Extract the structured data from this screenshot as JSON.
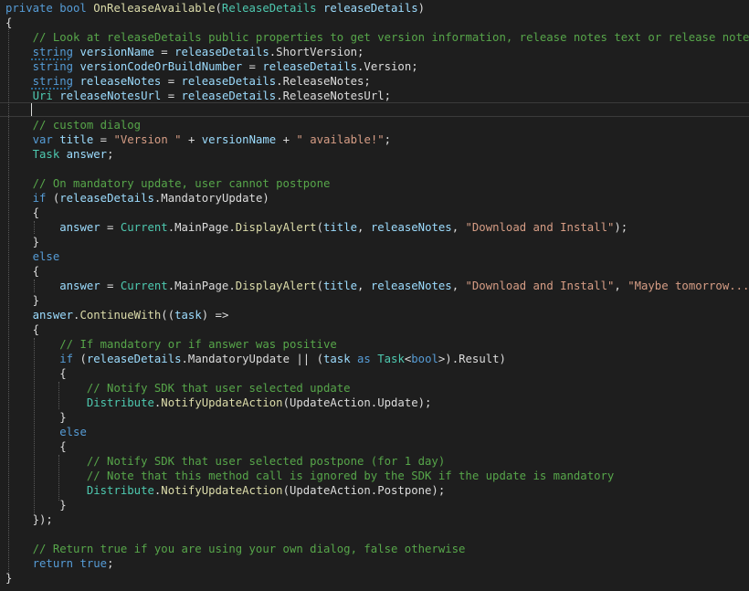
{
  "colors": {
    "background": "#1e1e1e",
    "plain": "#dcdcdc",
    "keyword": "#569cd6",
    "type": "#4ec9b0",
    "comment": "#57a64a",
    "string": "#d69d85",
    "parameter": "#9cdcfe",
    "method": "#dcdcaa"
  },
  "code_lines": [
    [
      [
        "kw",
        "private bool "
      ],
      [
        "me",
        "OnReleaseAvailable"
      ],
      [
        "pl",
        "("
      ],
      [
        "ty",
        "ReleaseDetails "
      ],
      [
        "pa",
        "releaseDetails"
      ],
      [
        "pl",
        ")"
      ]
    ],
    [
      [
        "pl",
        "{"
      ]
    ],
    [
      [
        "pl",
        "    "
      ],
      [
        "cm",
        "// Look at releaseDetails public properties to get version information, release notes text or release notes URL"
      ]
    ],
    [
      [
        "pl",
        "    "
      ],
      [
        "kw",
        "string "
      ],
      [
        "pa",
        "versionName"
      ],
      [
        "pl",
        " = "
      ],
      [
        "pa",
        "releaseDetails"
      ],
      [
        "pl",
        ".ShortVersion;"
      ]
    ],
    [
      [
        "pl",
        "    "
      ],
      [
        "kw",
        "string "
      ],
      [
        "pa",
        "versionCodeOrBuildNumber"
      ],
      [
        "pl",
        " = "
      ],
      [
        "pa",
        "releaseDetails"
      ],
      [
        "pl",
        ".Version;"
      ]
    ],
    [
      [
        "pl",
        "    "
      ],
      [
        "kw",
        "string "
      ],
      [
        "pa",
        "releaseNotes"
      ],
      [
        "pl",
        " = "
      ],
      [
        "pa",
        "releaseDetails"
      ],
      [
        "pl",
        ".ReleaseNotes;"
      ]
    ],
    [
      [
        "pl",
        "    "
      ],
      [
        "ty",
        "Uri "
      ],
      [
        "pa",
        "releaseNotesUrl"
      ],
      [
        "pl",
        " = "
      ],
      [
        "pa",
        "releaseDetails"
      ],
      [
        "pl",
        ".ReleaseNotesUrl;"
      ]
    ],
    [
      [
        "pl",
        ""
      ]
    ],
    [
      [
        "pl",
        "    "
      ],
      [
        "cm",
        "// custom dialog"
      ]
    ],
    [
      [
        "pl",
        "    "
      ],
      [
        "kw",
        "var "
      ],
      [
        "pa",
        "title"
      ],
      [
        "pl",
        " = "
      ],
      [
        "st",
        "\"Version \""
      ],
      [
        "pl",
        " + "
      ],
      [
        "pa",
        "versionName"
      ],
      [
        "pl",
        " + "
      ],
      [
        "st",
        "\" available!\""
      ],
      [
        "pl",
        ";"
      ]
    ],
    [
      [
        "pl",
        "    "
      ],
      [
        "ty",
        "Task "
      ],
      [
        "pa",
        "answer"
      ],
      [
        "pl",
        ";"
      ]
    ],
    [
      [
        "pl",
        ""
      ]
    ],
    [
      [
        "pl",
        "    "
      ],
      [
        "cm",
        "// On mandatory update, user cannot postpone"
      ]
    ],
    [
      [
        "pl",
        "    "
      ],
      [
        "kw",
        "if "
      ],
      [
        "pl",
        "("
      ],
      [
        "pa",
        "releaseDetails"
      ],
      [
        "pl",
        ".MandatoryUpdate)"
      ]
    ],
    [
      [
        "pl",
        "    {"
      ]
    ],
    [
      [
        "pl",
        "        "
      ],
      [
        "pa",
        "answer"
      ],
      [
        "pl",
        " = "
      ],
      [
        "ty",
        "Current"
      ],
      [
        "pl",
        ".MainPage."
      ],
      [
        "me",
        "DisplayAlert"
      ],
      [
        "pl",
        "("
      ],
      [
        "pa",
        "title"
      ],
      [
        "pl",
        ", "
      ],
      [
        "pa",
        "releaseNotes"
      ],
      [
        "pl",
        ", "
      ],
      [
        "st",
        "\"Download and Install\""
      ],
      [
        "pl",
        ");"
      ]
    ],
    [
      [
        "pl",
        "    }"
      ]
    ],
    [
      [
        "pl",
        "    "
      ],
      [
        "kw",
        "else"
      ]
    ],
    [
      [
        "pl",
        "    {"
      ]
    ],
    [
      [
        "pl",
        "        "
      ],
      [
        "pa",
        "answer"
      ],
      [
        "pl",
        " = "
      ],
      [
        "ty",
        "Current"
      ],
      [
        "pl",
        ".MainPage."
      ],
      [
        "me",
        "DisplayAlert"
      ],
      [
        "pl",
        "("
      ],
      [
        "pa",
        "title"
      ],
      [
        "pl",
        ", "
      ],
      [
        "pa",
        "releaseNotes"
      ],
      [
        "pl",
        ", "
      ],
      [
        "st",
        "\"Download and Install\""
      ],
      [
        "pl",
        ", "
      ],
      [
        "st",
        "\"Maybe tomorrow...\""
      ],
      [
        "pl",
        ");"
      ]
    ],
    [
      [
        "pl",
        "    }"
      ]
    ],
    [
      [
        "pl",
        "    "
      ],
      [
        "pa",
        "answer"
      ],
      [
        "pl",
        "."
      ],
      [
        "me",
        "ContinueWith"
      ],
      [
        "pl",
        "(("
      ],
      [
        "pa",
        "task"
      ],
      [
        "pl",
        ") =>"
      ]
    ],
    [
      [
        "pl",
        "    {"
      ]
    ],
    [
      [
        "pl",
        "        "
      ],
      [
        "cm",
        "// If mandatory or if answer was positive"
      ]
    ],
    [
      [
        "pl",
        "        "
      ],
      [
        "kw",
        "if "
      ],
      [
        "pl",
        "("
      ],
      [
        "pa",
        "releaseDetails"
      ],
      [
        "pl",
        ".MandatoryUpdate || ("
      ],
      [
        "pa",
        "task"
      ],
      [
        "pl",
        " "
      ],
      [
        "kw",
        "as "
      ],
      [
        "ty",
        "Task"
      ],
      [
        "pl",
        "<"
      ],
      [
        "kw",
        "bool"
      ],
      [
        "pl",
        ">).Result)"
      ]
    ],
    [
      [
        "pl",
        "        {"
      ]
    ],
    [
      [
        "pl",
        "            "
      ],
      [
        "cm",
        "// Notify SDK that user selected update"
      ]
    ],
    [
      [
        "pl",
        "            "
      ],
      [
        "ty",
        "Distribute"
      ],
      [
        "pl",
        "."
      ],
      [
        "me",
        "NotifyUpdateAction"
      ],
      [
        "pl",
        "(UpdateAction.Update);"
      ]
    ],
    [
      [
        "pl",
        "        }"
      ]
    ],
    [
      [
        "pl",
        "        "
      ],
      [
        "kw",
        "else"
      ]
    ],
    [
      [
        "pl",
        "        {"
      ]
    ],
    [
      [
        "pl",
        "            "
      ],
      [
        "cm",
        "// Notify SDK that user selected postpone (for 1 day)"
      ]
    ],
    [
      [
        "pl",
        "            "
      ],
      [
        "cm",
        "// Note that this method call is ignored by the SDK if the update is mandatory"
      ]
    ],
    [
      [
        "pl",
        "            "
      ],
      [
        "ty",
        "Distribute"
      ],
      [
        "pl",
        "."
      ],
      [
        "me",
        "NotifyUpdateAction"
      ],
      [
        "pl",
        "(UpdateAction.Postpone);"
      ]
    ],
    [
      [
        "pl",
        "        }"
      ]
    ],
    [
      [
        "pl",
        "    });"
      ]
    ],
    [
      [
        "pl",
        ""
      ]
    ],
    [
      [
        "pl",
        "    "
      ],
      [
        "cm",
        "// Return true if you are using your own dialog, false otherwise"
      ]
    ],
    [
      [
        "pl",
        "    "
      ],
      [
        "kw",
        "return "
      ],
      [
        "kw",
        "true"
      ],
      [
        "pl",
        ";"
      ]
    ],
    [
      [
        "pl",
        "}"
      ]
    ]
  ]
}
